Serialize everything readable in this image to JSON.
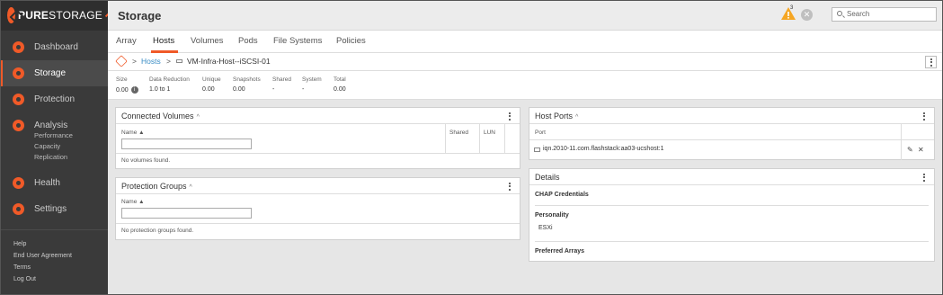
{
  "brand": {
    "name_bold": "PURE",
    "name_thin": "STORAGE"
  },
  "sidebar": {
    "items": [
      {
        "label": "Dashboard"
      },
      {
        "label": "Storage"
      },
      {
        "label": "Protection"
      },
      {
        "label": "Analysis"
      },
      {
        "label": "Health"
      },
      {
        "label": "Settings"
      }
    ],
    "analysis_sub": [
      "Performance",
      "Capacity",
      "Replication"
    ],
    "footer": [
      "Help",
      "End User Agreement",
      "Terms",
      "Log Out"
    ]
  },
  "header": {
    "title": "Storage",
    "alert_count": "3",
    "search_placeholder": "Search"
  },
  "tabs": [
    "Array",
    "Hosts",
    "Volumes",
    "Pods",
    "File Systems",
    "Policies"
  ],
  "active_tab": "Hosts",
  "breadcrumb": {
    "sep": ">",
    "hosts": "Hosts",
    "host_name": "VM-Infra-Host--iSCSI-01"
  },
  "stats": [
    {
      "label": "Size",
      "value": "0.00"
    },
    {
      "label": "Data Reduction",
      "value": "1.0 to 1"
    },
    {
      "label": "Unique",
      "value": "0.00"
    },
    {
      "label": "Snapshots",
      "value": "0.00"
    },
    {
      "label": "Shared",
      "value": "-"
    },
    {
      "label": "System",
      "value": "-"
    },
    {
      "label": "Total",
      "value": "0.00"
    }
  ],
  "connected_volumes": {
    "title": "Connected Volumes",
    "col_name": "Name",
    "col_shared": "Shared",
    "col_lun": "LUN",
    "empty": "No volumes found."
  },
  "protection_groups": {
    "title": "Protection Groups",
    "col_name": "Name",
    "empty": "No protection groups found."
  },
  "host_ports": {
    "title": "Host Ports",
    "col_port": "Port",
    "port_value": "iqn.2010-11.com.flashstack:aa03-ucshost:1"
  },
  "details": {
    "title": "Details",
    "chap": "CHAP Credentials",
    "personality_label": "Personality",
    "personality_value": "ESXi",
    "preferred_arrays": "Preferred Arrays"
  },
  "colors": {
    "accent": "#f05a28",
    "link": "#3a8dc5",
    "sidebar": "#3a3a3a"
  }
}
